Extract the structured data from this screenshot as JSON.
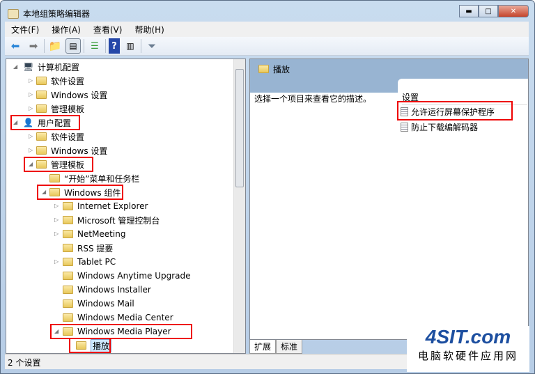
{
  "window": {
    "title": "本地组策略编辑器"
  },
  "menu": [
    "文件(F)",
    "操作(A)",
    "查看(V)",
    "帮助(H)"
  ],
  "tree": [
    {
      "label": "计算机配置",
      "level": 0,
      "state": "expanded",
      "icon": "computer-icon"
    },
    {
      "label": "软件设置",
      "level": 1,
      "state": "collapsed"
    },
    {
      "label": "Windows 设置",
      "level": 1,
      "state": "collapsed"
    },
    {
      "label": "管理模板",
      "level": 1,
      "state": "collapsed"
    },
    {
      "label": "用户配置",
      "level": 0,
      "state": "expanded",
      "icon": "user-icon",
      "highlight": true
    },
    {
      "label": "软件设置",
      "level": 1,
      "state": "collapsed"
    },
    {
      "label": "Windows 设置",
      "level": 1,
      "state": "collapsed"
    },
    {
      "label": "管理模板",
      "level": 1,
      "state": "expanded",
      "highlight": true
    },
    {
      "label": "“开始”菜单和任务栏",
      "level": 2,
      "state": "leaf"
    },
    {
      "label": "Windows 组件",
      "level": 2,
      "state": "expanded",
      "highlight": true
    },
    {
      "label": "Internet Explorer",
      "level": 3,
      "state": "collapsed"
    },
    {
      "label": "Microsoft 管理控制台",
      "level": 3,
      "state": "collapsed"
    },
    {
      "label": "NetMeeting",
      "level": 3,
      "state": "collapsed"
    },
    {
      "label": "RSS 提要",
      "level": 3,
      "state": "leaf"
    },
    {
      "label": "Tablet PC",
      "level": 3,
      "state": "collapsed"
    },
    {
      "label": "Windows Anytime Upgrade",
      "level": 3,
      "state": "leaf"
    },
    {
      "label": "Windows Installer",
      "level": 3,
      "state": "leaf"
    },
    {
      "label": "Windows Mail",
      "level": 3,
      "state": "leaf"
    },
    {
      "label": "Windows Media Center",
      "level": 3,
      "state": "leaf"
    },
    {
      "label": "Windows Media Player",
      "level": 3,
      "state": "expanded",
      "highlight": true
    },
    {
      "label": "播放",
      "level": 4,
      "state": "leaf",
      "selected": true,
      "highlight": true
    }
  ],
  "right": {
    "header": "播放",
    "description": "选择一个项目来查看它的描述。",
    "settings_header": "设置",
    "items": [
      "允许运行屏幕保护程序",
      "防止下载编解码器"
    ]
  },
  "tabs": [
    "扩展",
    "标准"
  ],
  "status": "2 个设置",
  "watermark": {
    "logo": "4SIT.com",
    "caption": "电脑软硬件应用网"
  },
  "colors": {
    "highlight_box": "#ee0000",
    "header_band": "#98b4d2"
  }
}
